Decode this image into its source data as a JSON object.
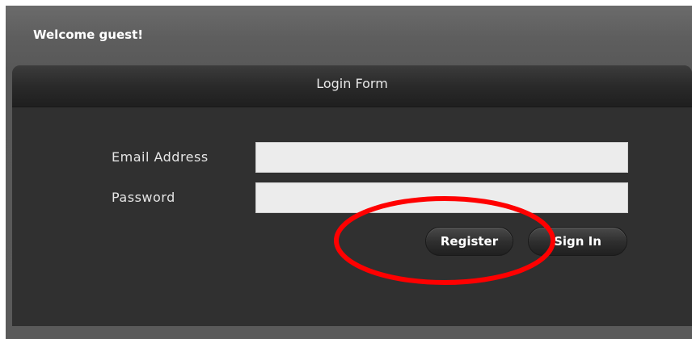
{
  "header": {
    "welcome_text": "Welcome guest!"
  },
  "login_form": {
    "title": "Login Form",
    "email_label": "Email Address",
    "email_value": "",
    "password_label": "Password",
    "password_value": "",
    "register_label": "Register",
    "signin_label": "Sign In"
  },
  "annotation": {
    "shape": "ellipse",
    "color": "#ff0000",
    "target": "register-button"
  }
}
